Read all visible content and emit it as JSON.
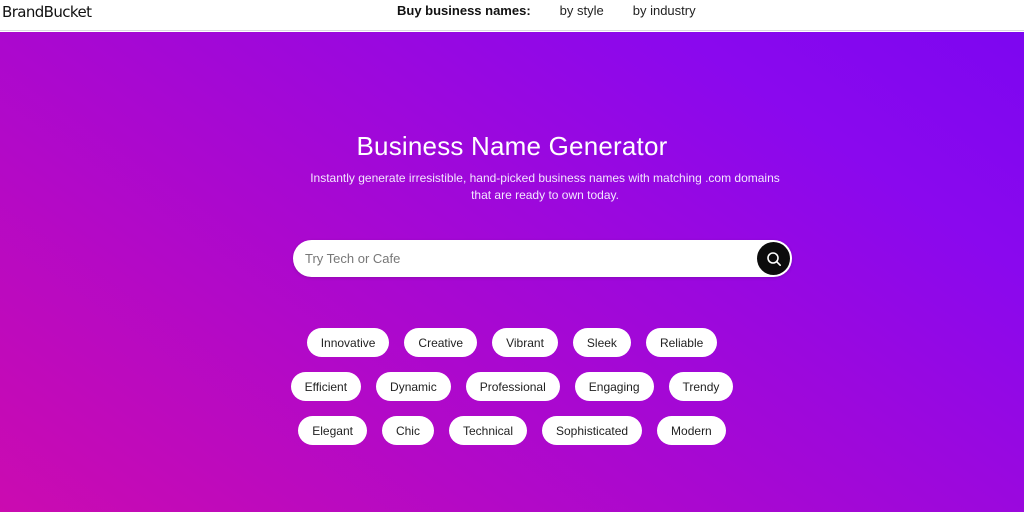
{
  "header": {
    "logo": "BrandBucket",
    "nav_label": "Buy business names:",
    "nav_links": [
      "by style",
      "by industry"
    ]
  },
  "hero": {
    "title": "Business Name Generator",
    "subtitle": "Instantly generate irresistible, hand-picked business names with matching .com domains that are ready to own today.",
    "search": {
      "placeholder": "Try Tech or Cafe",
      "value": "",
      "button_icon": "search-icon"
    },
    "tags": [
      [
        "Innovative",
        "Creative",
        "Vibrant",
        "Sleek",
        "Reliable"
      ],
      [
        "Efficient",
        "Dynamic",
        "Professional",
        "Engaging",
        "Trendy"
      ],
      [
        "Elegant",
        "Chic",
        "Technical",
        "Sophisticated",
        "Modern"
      ]
    ]
  },
  "colors": {
    "gradient_start": "#cb0bb0",
    "gradient_end": "#7d06f0",
    "search_button": "#0c0c0c"
  }
}
